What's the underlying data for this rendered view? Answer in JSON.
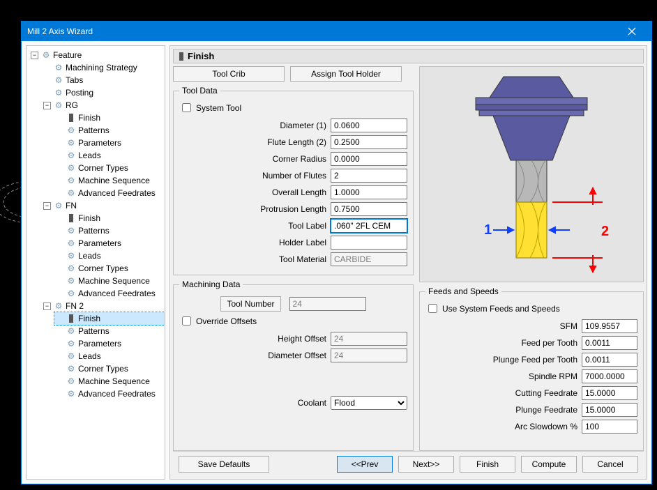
{
  "window": {
    "title": "Mill 2 Axis Wizard"
  },
  "tree": {
    "root": "Feature",
    "l1": {
      "a": "Machining Strategy",
      "b": "Tabs",
      "c": "Posting"
    },
    "groups": [
      "RG",
      "FN",
      "FN 2"
    ],
    "children": [
      "Finish",
      "Patterns",
      "Parameters",
      "Leads",
      "Corner Types",
      "Machine Sequence",
      "Advanced Feedrates"
    ]
  },
  "page": {
    "title": "Finish"
  },
  "buttons": {
    "tool_crib": "Tool Crib",
    "assign_holder": "Assign Tool Holder",
    "tool_number": "Tool Number"
  },
  "tool_data": {
    "legend": "Tool Data",
    "system_tool_label": "System Tool",
    "fields": {
      "diameter_label": "Diameter (1)",
      "diameter": "0.0600",
      "flute_length_label": "Flute Length (2)",
      "flute_length": "0.2500",
      "corner_radius_label": "Corner Radius",
      "corner_radius": "0.0000",
      "num_flutes_label": "Number of Flutes",
      "num_flutes": "2",
      "overall_length_label": "Overall Length",
      "overall_length": "1.0000",
      "protrusion_label": "Protrusion Length",
      "protrusion": "0.7500",
      "tool_label_label": "Tool Label",
      "tool_label": ".060\" 2FL CEM",
      "holder_label_label": "Holder Label",
      "holder_label": "",
      "tool_material_label": "Tool Material",
      "tool_material": "CARBIDE"
    }
  },
  "machining_data": {
    "legend": "Machining Data",
    "tool_number": "24",
    "override_offsets_label": "Override Offsets",
    "height_offset_label": "Height Offset",
    "height_offset": "24",
    "diameter_offset_label": "Diameter Offset",
    "diameter_offset": "24",
    "coolant_label": "Coolant",
    "coolant": "Flood"
  },
  "feeds": {
    "legend": "Feeds and Speeds",
    "use_system_label": "Use System Feeds and Speeds",
    "sfm_label": "SFM",
    "sfm": "109.9557",
    "feed_per_tooth_label": "Feed per Tooth",
    "feed_per_tooth": "0.0011",
    "plunge_feed_per_tooth_label": "Plunge Feed per Tooth",
    "plunge_feed_per_tooth": "0.0011",
    "spindle_rpm_label": "Spindle RPM",
    "spindle_rpm": "7000.0000",
    "cutting_feedrate_label": "Cutting Feedrate",
    "cutting_feedrate": "15.0000",
    "plunge_feedrate_label": "Plunge Feedrate",
    "plunge_feedrate": "15.0000",
    "arc_slowdown_label": "Arc Slowdown %",
    "arc_slowdown": "100"
  },
  "viewer": {
    "label1": "1",
    "label2": "2"
  },
  "footer": {
    "save_defaults": "Save Defaults",
    "prev": "<<Prev",
    "next": "Next>>",
    "finish": "Finish",
    "compute": "Compute",
    "cancel": "Cancel"
  }
}
